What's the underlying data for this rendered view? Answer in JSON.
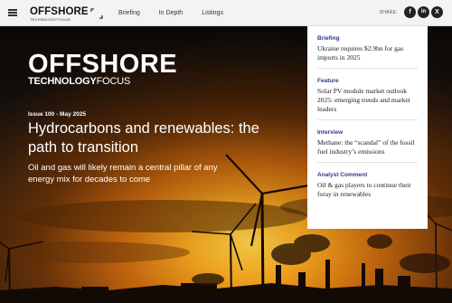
{
  "topbar": {
    "logo_main": "OFFSHORE",
    "logo_sub": "TECHNOLOGYFOCUS",
    "nav": [
      "Briefing",
      "In Depth",
      "Listings"
    ],
    "share_label": "SHARE:",
    "social": [
      {
        "icon": "facebook-icon",
        "glyph": "f"
      },
      {
        "icon": "linkedin-icon",
        "glyph": "in"
      },
      {
        "icon": "x-icon",
        "glyph": "X"
      }
    ]
  },
  "hero": {
    "brand_line1": "OFFSHORE",
    "brand_line2_bold": "TECHNOLOGY",
    "brand_line2_thin": "FOCUS",
    "issue": "Issue 100 - May 2025",
    "headline": "Hydrocarbons and renewables: the path to transition",
    "standfirst": "Oil and gas will likely remain a central pillar of any energy mix for decades to come"
  },
  "sidebar": {
    "items": [
      {
        "kicker": "Briefing",
        "title": "Ukraine requires $2.9bn for gas imports in 2025"
      },
      {
        "kicker": "Feature",
        "title": "Solar PV module market outlook 2025: emerging trends and market leaders"
      },
      {
        "kicker": "Interview",
        "title": "Methane: the “scandal” of the fossil fuel industry’s emissions"
      },
      {
        "kicker": "Analyst Comment",
        "title": "Oil & gas players to continue their foray in renewables"
      }
    ]
  },
  "colors": {
    "kicker": "#2d3a8c",
    "sky_top": "#1a1410",
    "sky_glow": "#f0a81e"
  }
}
